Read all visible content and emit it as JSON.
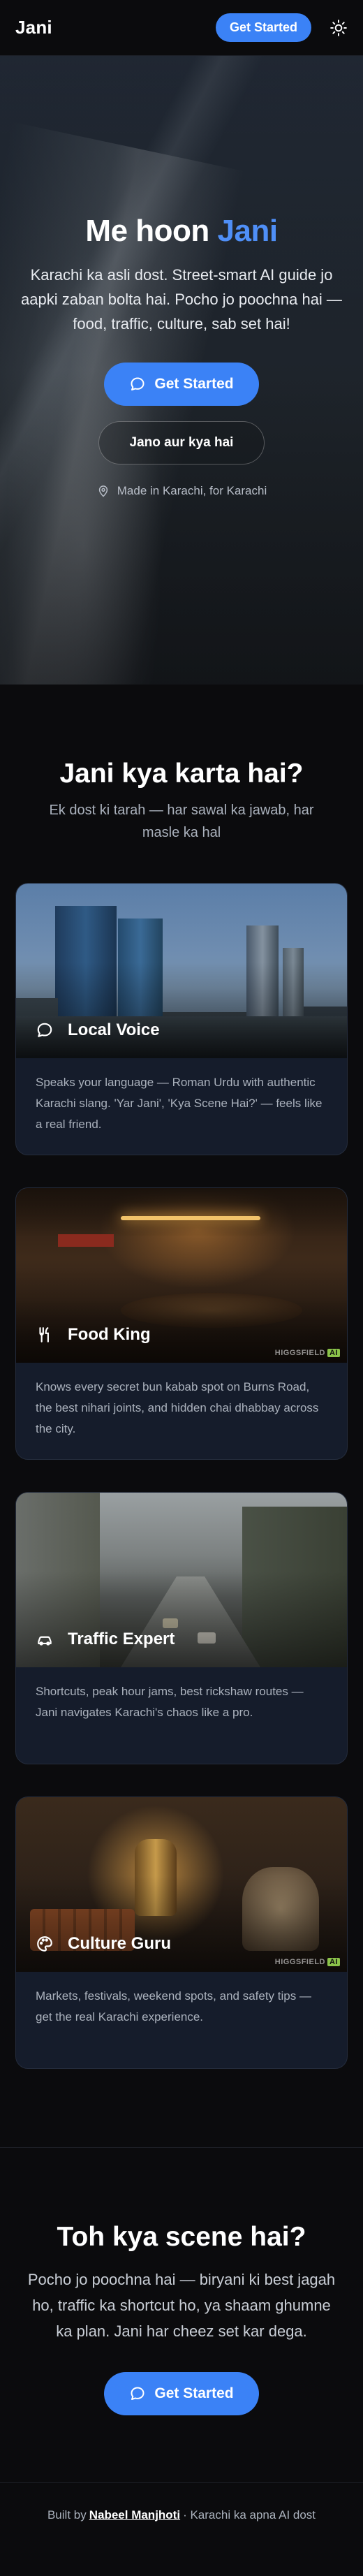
{
  "header": {
    "brand": "Jani",
    "cta_label": "Get Started",
    "theme_toggle_icon": "sun-icon"
  },
  "hero": {
    "title_prefix": "Me hoon",
    "title_accent": "Jani",
    "subtitle": "Karachi ka asli dost. Street-smart AI guide jo aapki zaban bolta hai. Pocho jo poochna hai — food, traffic, culture, sab set hai!",
    "primary_button": "Get Started",
    "secondary_button": "Jano aur kya hai",
    "note": "Made in Karachi, for Karachi",
    "accent_color": "#4f8ff7"
  },
  "features": {
    "title": "Jani kya karta hai?",
    "subtitle": "Ek dost ki tarah — har sawal ka jawab, har masle ka hal",
    "cards": [
      {
        "title": "Local Voice",
        "icon": "chat-bubble-icon",
        "description": "Speaks your language — Roman Urdu with authentic Karachi slang. 'Yar Jani', 'Kya Scene Hai?' — feels like a real friend.",
        "watermark": ""
      },
      {
        "title": "Food King",
        "icon": "fork-knife-icon",
        "description": "Knows every secret bun kabab spot on Burns Road, the best nihari joints, and hidden chai dhabbay across the city.",
        "watermark": "HIGGSFIELD"
      },
      {
        "title": "Traffic Expert",
        "icon": "car-icon",
        "description": "Shortcuts, peak hour jams, best rickshaw routes — Jani navigates Karachi's chaos like a pro.",
        "watermark": ""
      },
      {
        "title": "Culture Guru",
        "icon": "palette-icon",
        "description": "Markets, festivals, weekend spots, and safety tips — get the real Karachi experience.",
        "watermark": "HIGGSFIELD"
      }
    ]
  },
  "cta": {
    "title": "Toh kya scene hai?",
    "subtitle": "Pocho jo poochna hai — biryani ki best jagah ho, traffic ka shortcut ho, ya shaam ghumne ka plan. Jani har cheez set kar dega.",
    "button": "Get Started"
  },
  "footer": {
    "prefix": "Built by",
    "author": "Nabeel Manjhoti",
    "suffix": "· Karachi ka apna AI dost"
  },
  "colors": {
    "primary": "#3b82f6",
    "background": "#0b0b0d",
    "card": "#151c2b"
  }
}
